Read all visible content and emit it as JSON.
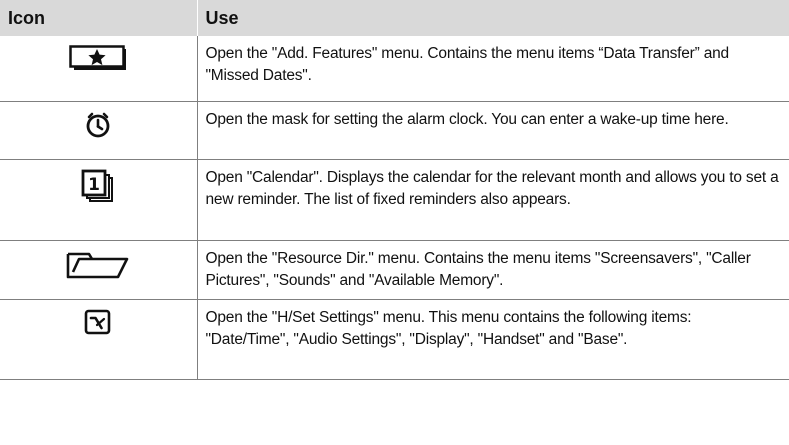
{
  "header": {
    "icon_col": "Icon",
    "use_col": "Use"
  },
  "colors": {
    "header_bg": "#d9d9d9",
    "rule": "#7f7f7f",
    "text": "#111111"
  },
  "rows": [
    {
      "icon": "star-key-icon",
      "text": "Open the \"Add. Features\" menu. Contains the menu items “Data Transfer” and \"Missed Dates\"."
    },
    {
      "icon": "alarm-clock-icon",
      "text": "Open the mask for setting the alarm clock. You can enter a wake-up time here."
    },
    {
      "icon": "calendar-icon",
      "text": "Open \"Calendar\". Displays the calendar for the relevant month and allows you to set a new reminder. The list of fixed reminders also appears."
    },
    {
      "icon": "folder-icon",
      "text": "Open the \"Resource Dir.\" menu. Contains the menu items \"Screensavers\", \"Caller Pictures\", \"Sounds\" and \"Available Memory\"."
    },
    {
      "icon": "settings-icon",
      "text": "Open the \"H/Set Settings\" menu. This menu contains the following items: \"Date/Time\", \"Audio Settings\", \"Display\", \"Handset\" and \"Base\"."
    }
  ]
}
